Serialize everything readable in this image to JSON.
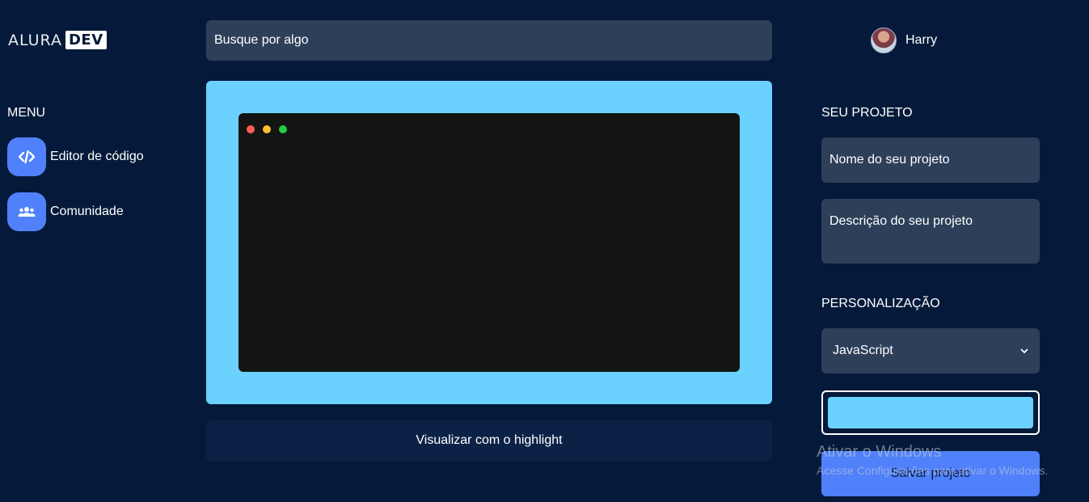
{
  "logo": {
    "text": "ALURA",
    "box": "DEV"
  },
  "search": {
    "placeholder": "Busque por algo"
  },
  "user": {
    "name": "Harry"
  },
  "menu": {
    "title": "MENU",
    "items": [
      {
        "label": "Editor de código",
        "icon": "code-icon"
      },
      {
        "label": "Comunidade",
        "icon": "users-icon"
      }
    ]
  },
  "editor": {
    "dots": [
      "#ff5f56",
      "#ffbd2e",
      "#27c93f"
    ],
    "frame_color": "#6bd1ff",
    "background": "#141414"
  },
  "highlight_button": {
    "label": "Visualizar com o highlight"
  },
  "project": {
    "title": "SEU PROJETO",
    "name_placeholder": "Nome do seu projeto",
    "description_placeholder": "Descrição do seu projeto"
  },
  "customization": {
    "title": "PERSONALIZAÇÃO",
    "language": "JavaScript",
    "color": "#6bd1ff"
  },
  "save_button": {
    "label": "Salvar projeto"
  },
  "watermark": {
    "title": "Ativar o Windows",
    "subtitle": "Acesse Configurações para ativar o Windows."
  },
  "colors": {
    "background": "#051a3a",
    "accent": "#5081fb",
    "field": "#2d3f59"
  }
}
